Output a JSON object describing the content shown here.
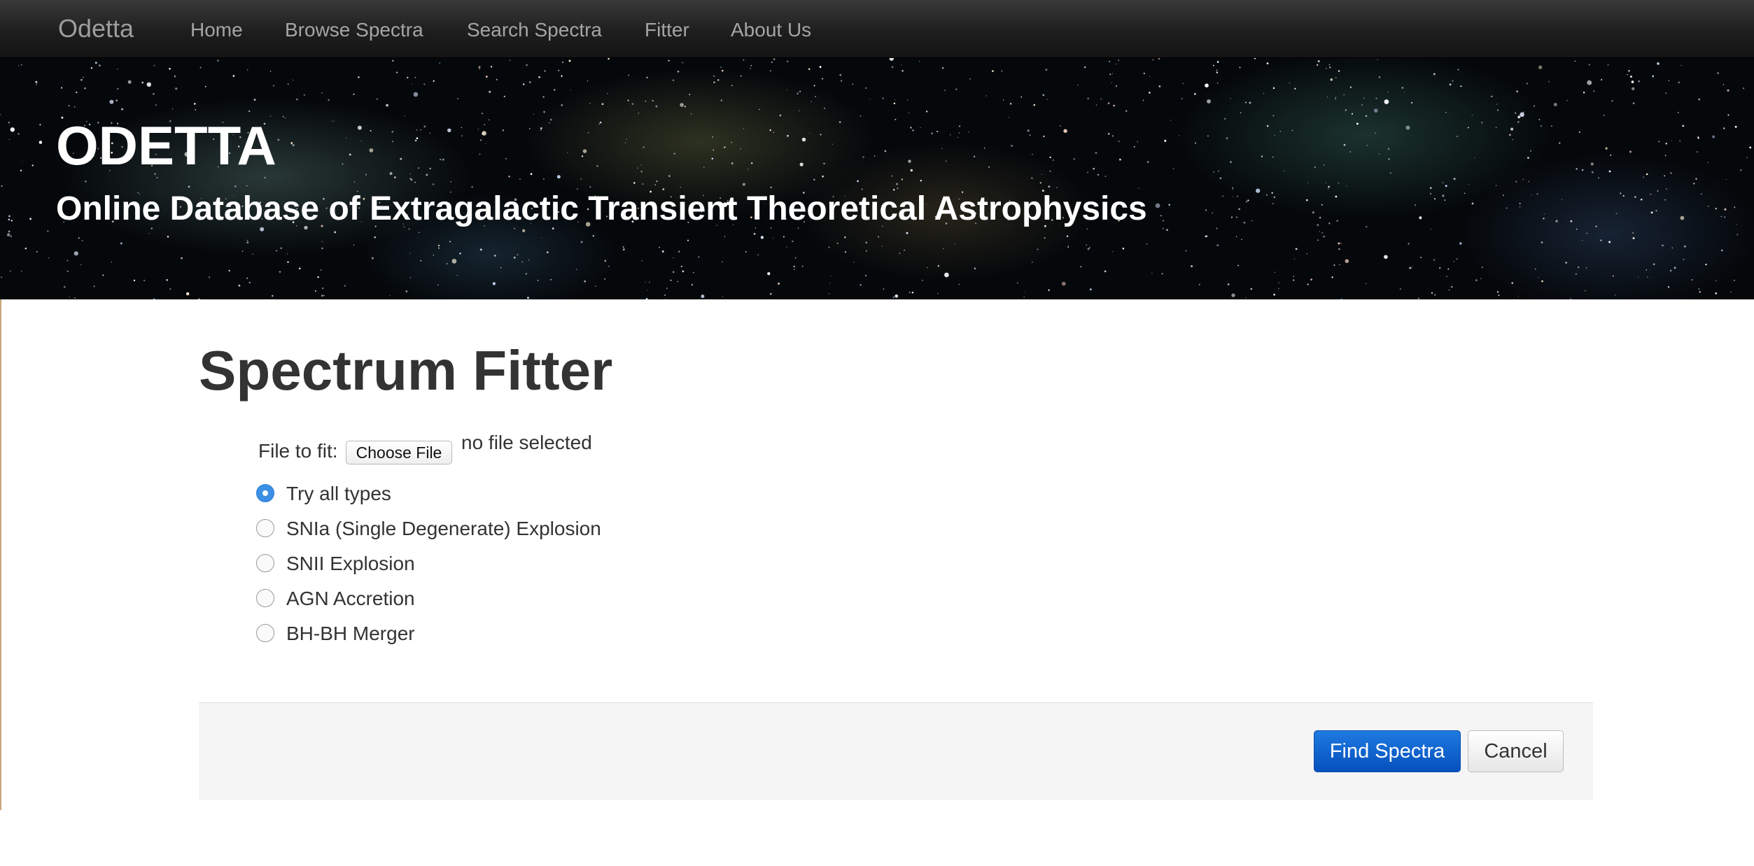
{
  "navbar": {
    "brand": "Odetta",
    "items": [
      {
        "label": "Home"
      },
      {
        "label": "Browse Spectra"
      },
      {
        "label": "Search Spectra"
      },
      {
        "label": "Fitter"
      },
      {
        "label": "About Us"
      }
    ]
  },
  "hero": {
    "title": "ODETTA",
    "subtitle": "Online Database of Extragalactic Transient Theoretical Astrophysics"
  },
  "main": {
    "page_title": "Spectrum Fitter",
    "file_input": {
      "label": "File to fit:",
      "button_label": "Choose File",
      "status": "no file selected"
    },
    "type_options": [
      {
        "label": "Try all types",
        "checked": true
      },
      {
        "label": "SNIa (Single Degenerate) Explosion",
        "checked": false
      },
      {
        "label": "SNII Explosion",
        "checked": false
      },
      {
        "label": "AGN Accretion",
        "checked": false
      },
      {
        "label": "BH-BH Merger",
        "checked": false
      }
    ],
    "actions": {
      "primary_label": "Find Spectra",
      "cancel_label": "Cancel"
    }
  },
  "colors": {
    "navbar_bg": "#222222",
    "primary_button": "#0a5fd0",
    "radio_checked": "#3b8fe4",
    "actions_bg": "#f5f5f5"
  }
}
